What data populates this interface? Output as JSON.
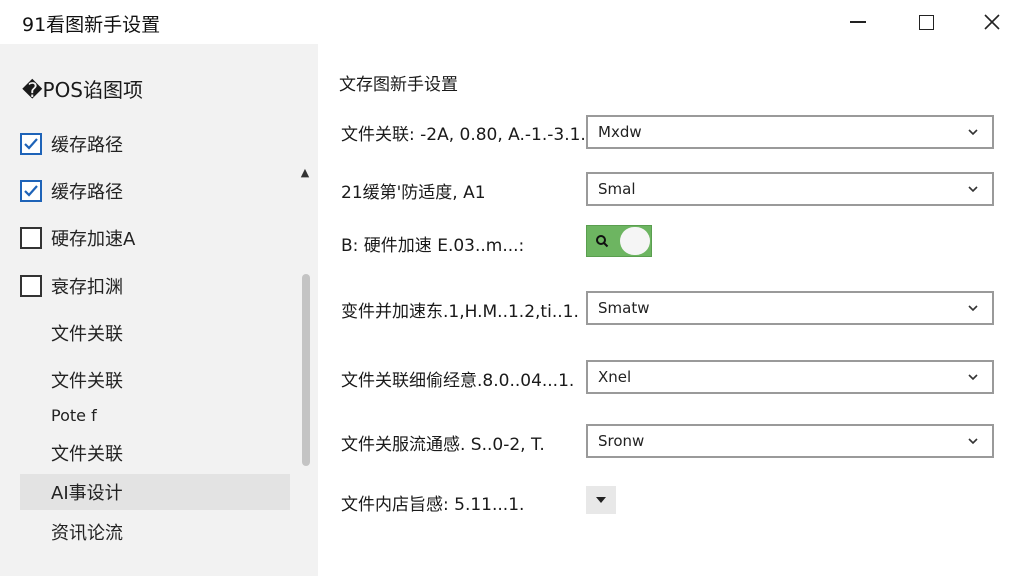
{
  "window": {
    "title": "91看图新手设置"
  },
  "sidebar": {
    "title": "�POS谄图项",
    "items": [
      {
        "label": "缓存路径",
        "checkbox": "checked"
      },
      {
        "label": "缓存路径",
        "checkbox": "checked"
      },
      {
        "label": "硬存加速A",
        "checkbox": "unchecked"
      },
      {
        "label": "衰存扣渊",
        "checkbox": "unchecked"
      },
      {
        "label": "文件关联",
        "checkbox": "none"
      },
      {
        "label": "文件关联",
        "checkbox": "none"
      },
      {
        "label": "Pote f",
        "checkbox": "none"
      },
      {
        "label": "文件关联",
        "checkbox": "none"
      },
      {
        "label": "AI事设计",
        "checkbox": "none",
        "selected": true
      },
      {
        "label": "资讯论流",
        "checkbox": "none"
      }
    ]
  },
  "main": {
    "title": "文存图新手设置",
    "rows": [
      {
        "label": "文件关联: -2A, 0.80, A.-1.-3.1.",
        "control": "dropdown",
        "value": "Mxdw"
      },
      {
        "label": "21缓第'防适度, A1",
        "control": "dropdown",
        "value": "Smal"
      },
      {
        "label": "B: 硬件加速      E.03..m...:",
        "control": "toggle",
        "value": "on"
      },
      {
        "label": "变件并加速东.1,H.M..1.2,ti..1.",
        "control": "dropdown",
        "value": "Smatw"
      },
      {
        "label": "文件关联细偷经意.8.0..04...1.",
        "control": "dropdown",
        "value": "Xnel"
      },
      {
        "label": "文件关服流通感. S..0-2, T.",
        "control": "dropdown",
        "value": "Sronw"
      },
      {
        "label": "文件内店旨感: 5.11...1.",
        "control": "small-dropdown",
        "value": ""
      }
    ]
  },
  "colors": {
    "toggle_on": "#6db561",
    "checkbox_accent": "#1e63b8",
    "sidebar_bg": "#f2f2f2"
  }
}
